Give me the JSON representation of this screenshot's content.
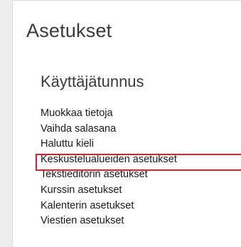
{
  "page": {
    "title": "Asetukset"
  },
  "section": {
    "title": "Käyttäjätunnus",
    "items": [
      {
        "label": "Muokkaa tietoja"
      },
      {
        "label": "Vaihda salasana"
      },
      {
        "label": "Haluttu kieli"
      },
      {
        "label": "Keskustelualueiden asetukset",
        "highlighted": true
      },
      {
        "label": "Tekstieditorin asetukset"
      },
      {
        "label": "Kurssin asetukset"
      },
      {
        "label": "Kalenterin asetukset"
      },
      {
        "label": "Viestien asetukset"
      }
    ]
  },
  "colors": {
    "highlight_border": "#d9232b",
    "text": "#1a1a1a",
    "heading": "#3a3a3a"
  }
}
